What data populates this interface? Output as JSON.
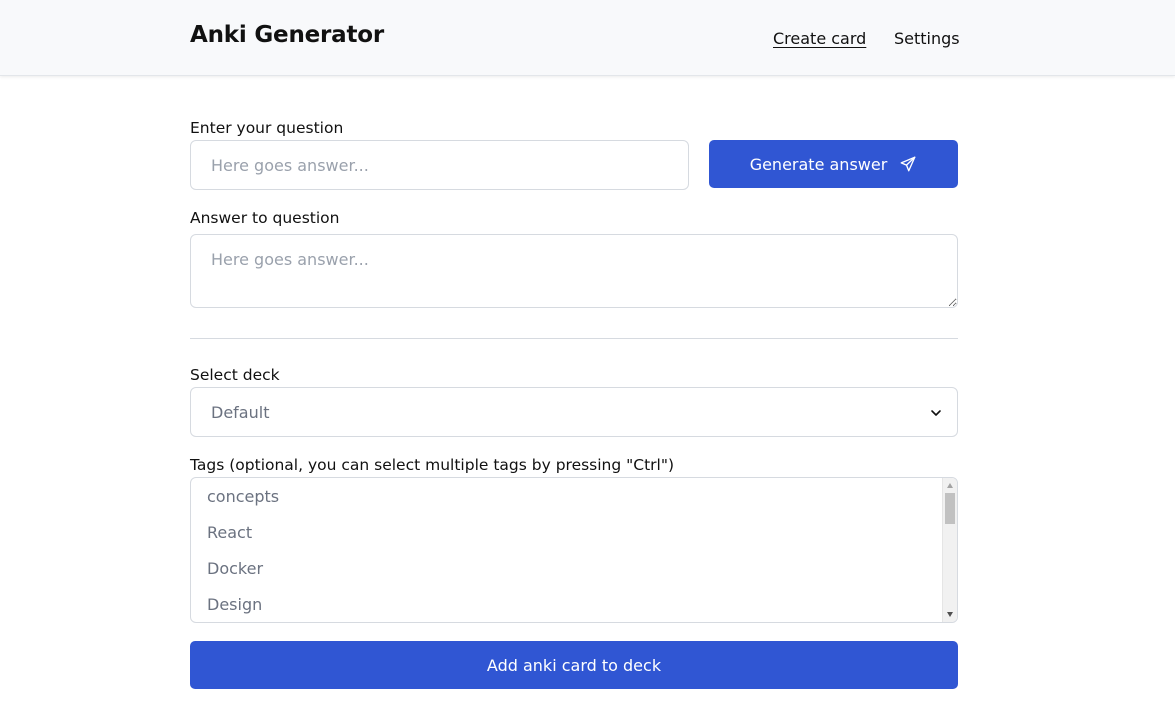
{
  "header": {
    "brand": "Anki Generator",
    "nav": {
      "create_card": "Create card",
      "settings": "Settings"
    }
  },
  "question": {
    "label": "Enter your question",
    "placeholder": "Here goes answer...",
    "value": ""
  },
  "generate_button": {
    "label": "Generate answer",
    "icon": "send-icon"
  },
  "answer": {
    "label": "Answer to question",
    "placeholder": "Here goes answer...",
    "value": ""
  },
  "deck": {
    "label": "Select deck",
    "selected": "Default",
    "icon": "chevron-down-icon"
  },
  "tags": {
    "label": "Tags (optional, you can select multiple tags by pressing \"Ctrl\")",
    "items": [
      "concepts",
      "React",
      "Docker",
      "Design"
    ]
  },
  "add_button": {
    "label": "Add anki card to deck"
  },
  "colors": {
    "primary": "#3056d3",
    "header_bg": "#f8f9fb",
    "border": "#d6dae0",
    "placeholder": "#9aa1ac",
    "muted_text": "#6b7280"
  }
}
